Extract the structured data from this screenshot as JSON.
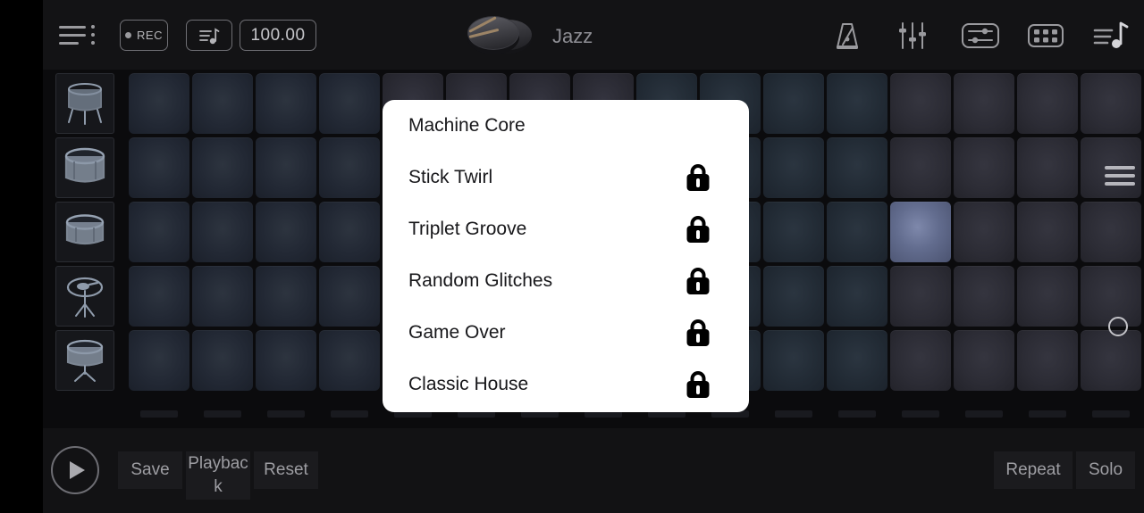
{
  "toolbar": {
    "menu_icon": "menu-lines-icon",
    "rec_label": "REC",
    "song_icon": "song-list-icon",
    "bpm_value": "100.00",
    "kit_name": "Jazz",
    "kit_icon": "drum-kit-icon",
    "right_icons": [
      {
        "name": "metronome-icon",
        "label": "Metronome"
      },
      {
        "name": "mixer-faders-icon",
        "label": "Mixer"
      },
      {
        "name": "settings-sliders-icon",
        "label": "Settings"
      },
      {
        "name": "pad-grid-icon",
        "label": "Pads"
      },
      {
        "name": "song-notes-icon",
        "label": "Song"
      }
    ]
  },
  "grid": {
    "menu_icon": "grid-menu-icon",
    "circle_icon": "record-circle-icon",
    "back_icon": "chevron-left-icon",
    "columns": 16,
    "rows": 5,
    "instruments": [
      {
        "name": "floor-tom-icon"
      },
      {
        "name": "bass-drum-icon"
      },
      {
        "name": "snare-drum-icon"
      },
      {
        "name": "hi-hat-cymbal-icon"
      },
      {
        "name": "snare-stand-icon"
      }
    ],
    "active_pad": {
      "row": 3,
      "col": 13
    }
  },
  "bottom": {
    "play_icon": "play-icon",
    "save_label": "Save",
    "playback_label": "Playback",
    "reset_label": "Reset",
    "repeat_label": "Repeat",
    "solo_label": "Solo"
  },
  "dialog": {
    "items": [
      {
        "label": "Machine Core",
        "locked": false
      },
      {
        "label": "Stick Twirl",
        "locked": true
      },
      {
        "label": "Triplet Groove",
        "locked": true
      },
      {
        "label": "Random Glitches",
        "locked": true
      },
      {
        "label": "Game Over",
        "locked": true
      },
      {
        "label": "Classic House",
        "locked": true
      }
    ],
    "lock_icon": "lock-icon"
  },
  "colors": {
    "background": "#0c0c0e",
    "toolbar": "#131315",
    "pad": "#242b35",
    "pad_active": "#4e5570",
    "dialog_bg": "#ffffff",
    "text_muted": "#9a9a9e"
  }
}
